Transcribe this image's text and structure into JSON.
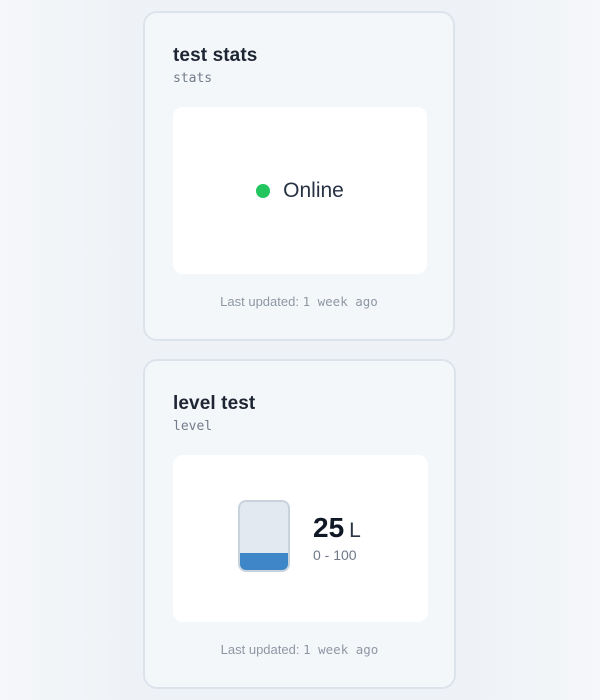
{
  "cards": [
    {
      "title": "test stats",
      "type": "stats",
      "status": {
        "text": "Online",
        "color": "#22c55e"
      },
      "footer": {
        "label": "Last updated:",
        "value": "1 week ago"
      }
    },
    {
      "title": "level test",
      "type": "level",
      "level": {
        "value": "25",
        "unit": "L",
        "range": "0 - 100",
        "fill_fraction": 0.25,
        "fill_color": "#3f86c9"
      },
      "footer": {
        "label": "Last updated:",
        "value": "1 week ago"
      }
    }
  ]
}
